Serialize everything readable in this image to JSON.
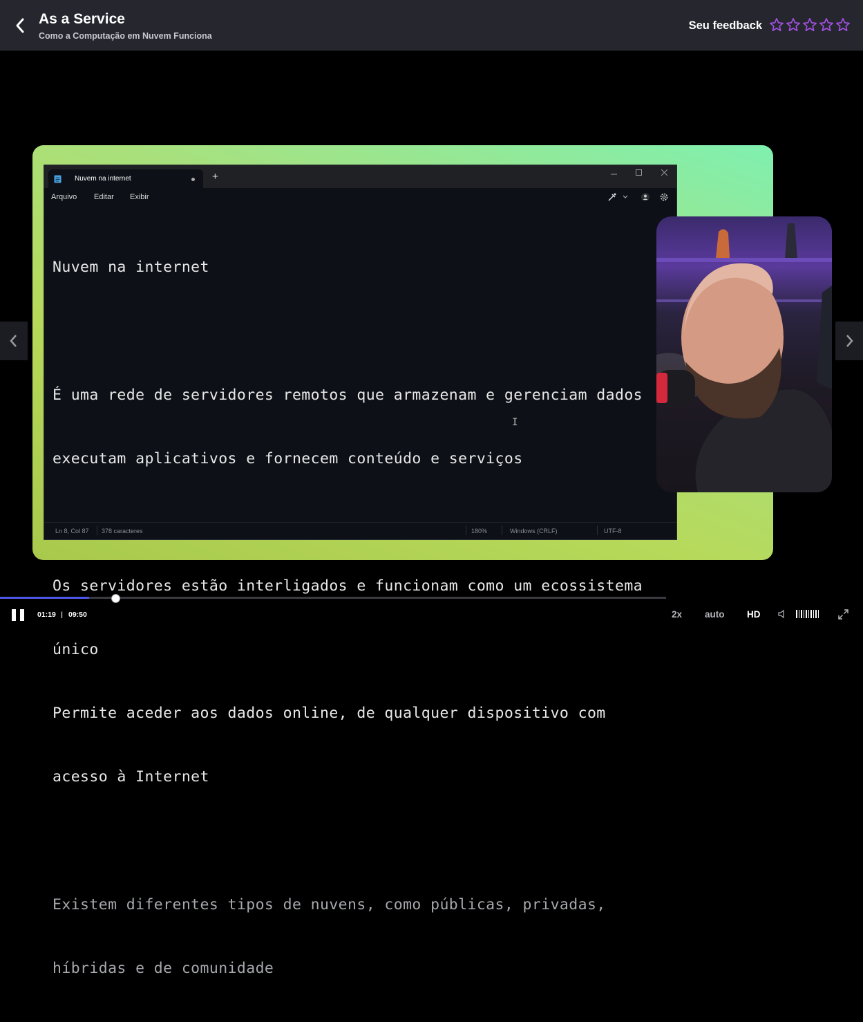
{
  "header": {
    "title": "As a Service",
    "subtitle": "Como a Computação em Nuvem Funciona",
    "feedback_label": "Seu feedback",
    "rating_stars": 5,
    "star_color": "#a552e6"
  },
  "notepad": {
    "tab_title": "Nuvem na internet",
    "new_tab": "+",
    "menu": [
      "Arquivo",
      "Editar",
      "Exibir"
    ],
    "content_lines": [
      "Nuvem na internet",
      "",
      "É uma rede de servidores remotos que armazenam e gerenciam dados",
      "executam aplicativos e fornecem conteúdo e serviços",
      "",
      "Os servidores estão interligados e funcionam como um ecossistema",
      "único",
      "Permite aceder aos dados online, de qualquer dispositivo com",
      "acesso à Internet",
      "",
      "Existem diferentes tipos de nuvens, como públicas, privadas,",
      "híbridas e de comunidade"
    ],
    "status": {
      "position": "Ln 8, Col 87",
      "chars": "378 caracteres",
      "zoom": "180%",
      "line_ending": "Windows (CRLF)",
      "encoding": "UTF-8"
    }
  },
  "player": {
    "current_time": "01:19",
    "separator": "|",
    "duration": "09:50",
    "progress_fraction": 0.134,
    "speed": "2x",
    "quality_mode": "auto",
    "quality": "HD",
    "accent_color": "#4d55e8"
  }
}
